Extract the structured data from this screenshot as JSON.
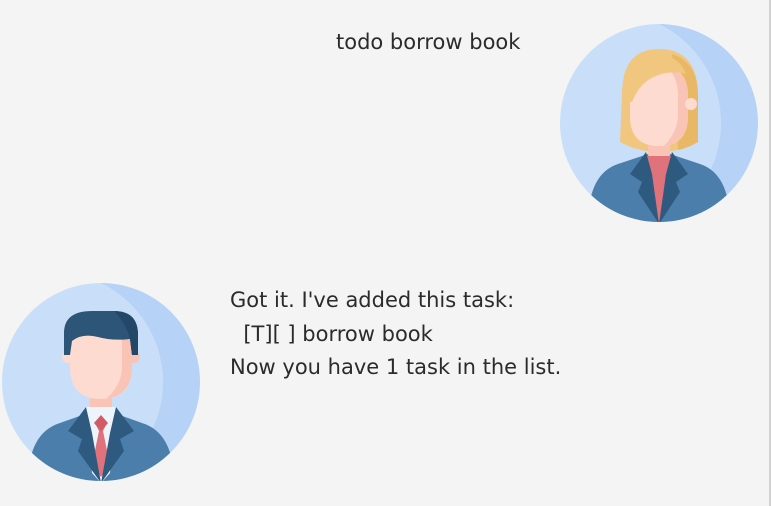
{
  "window": {
    "title": ""
  },
  "conversation": {
    "user_message": {
      "text": "todo borrow book",
      "avatar_icon": "woman-user-avatar-icon"
    },
    "bot_message": {
      "lines": [
        "Got it. I've added this task:",
        "  [T][ ] borrow book",
        "Now you have 1 task in the list."
      ],
      "avatar_icon": "man-bot-avatar-icon"
    }
  },
  "colors": {
    "background": "#f4f4f4",
    "avatar_circle": "#c9dff9",
    "avatar_circle_shade": "#b6d2f6",
    "suit": "#4b7eaa",
    "suit_dark": "#2e5a80",
    "skin": "#fddbd1",
    "skin_shadow": "#f9c3b6",
    "hair_blonde": "#f1c780",
    "hair_dark": "#2d5577",
    "tie": "#e0727b",
    "text": "#2b2b2b"
  }
}
